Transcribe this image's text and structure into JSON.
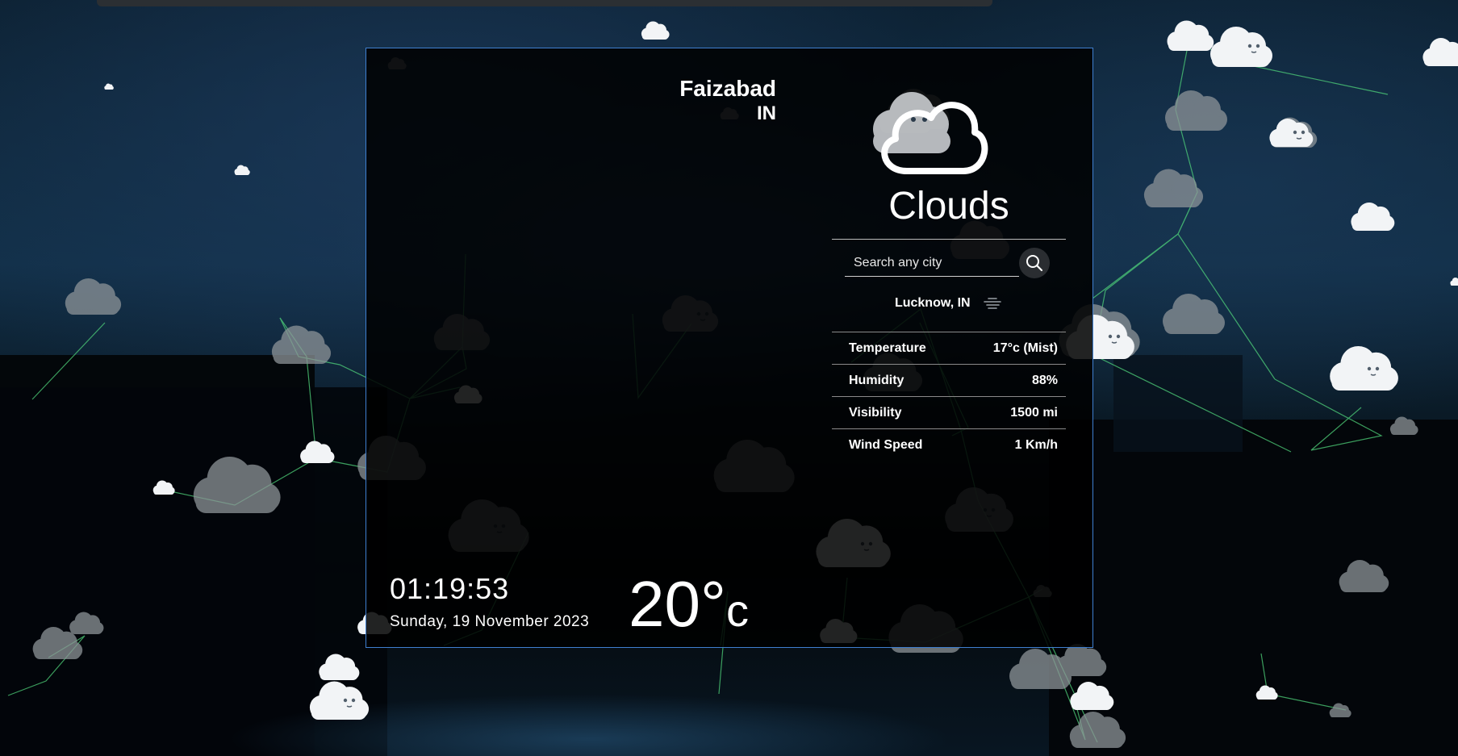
{
  "location": {
    "city": "Faizabad",
    "country": "IN"
  },
  "weather": {
    "condition": "Clouds",
    "icon": "cloud-outline-icon"
  },
  "search": {
    "placeholder": "Search any city"
  },
  "current_location": {
    "label": "Lucknow, IN",
    "icon": "mist-icon"
  },
  "details": [
    {
      "label": "Temperature",
      "value": "17°c (Mist)"
    },
    {
      "label": "Humidity",
      "value": "88%"
    },
    {
      "label": "Visibility",
      "value": "1500 mi"
    },
    {
      "label": "Wind Speed",
      "value": "1 Km/h"
    }
  ],
  "clock": {
    "time": "01:19:53",
    "date": "Sunday, 19 November 2023"
  },
  "temperature": {
    "value": "20",
    "degree": "°",
    "unit": "c"
  },
  "colors": {
    "accent_border": "#3f7fd0",
    "network_line": "#4fd27a",
    "card_bg": "#000000"
  }
}
